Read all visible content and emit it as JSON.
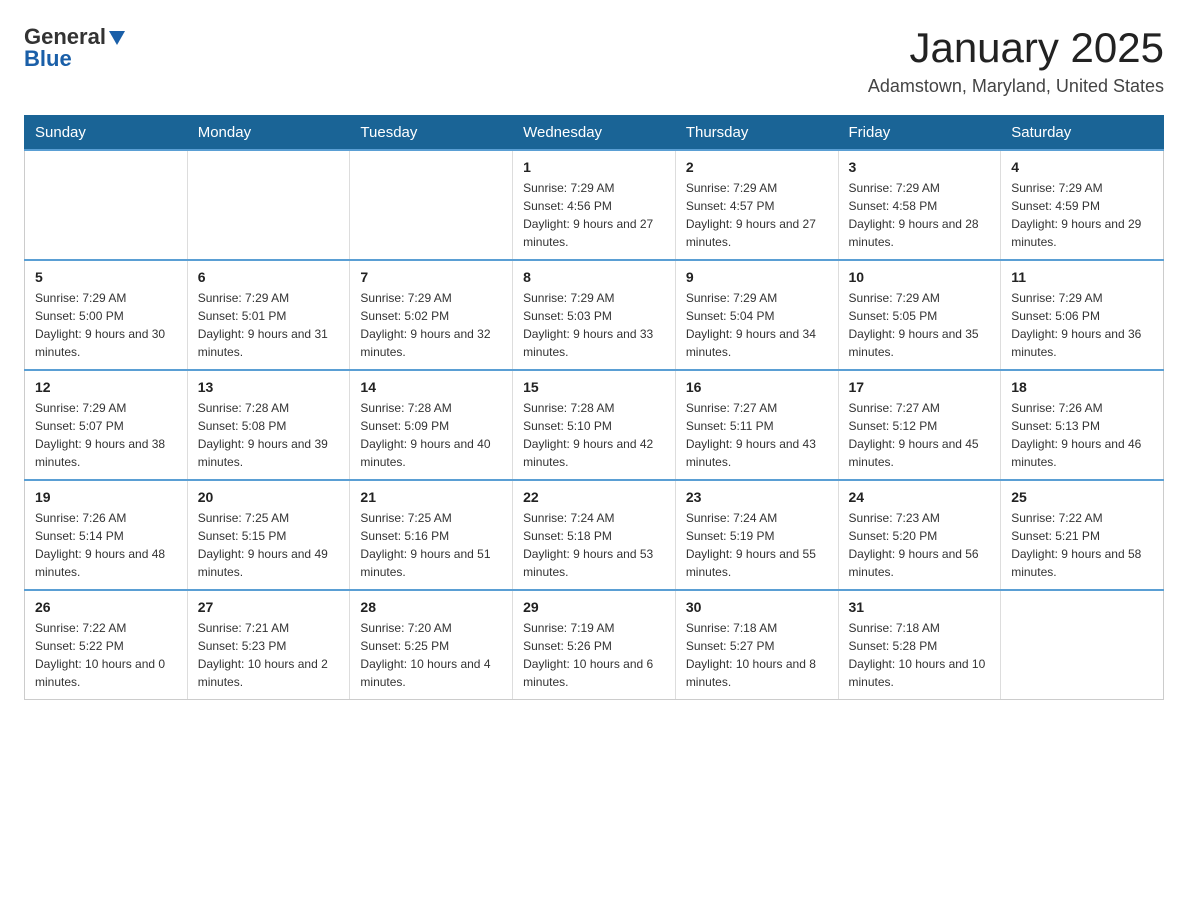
{
  "header": {
    "logo_general": "General",
    "logo_blue": "Blue",
    "title": "January 2025",
    "subtitle": "Adamstown, Maryland, United States"
  },
  "weekdays": [
    "Sunday",
    "Monday",
    "Tuesday",
    "Wednesday",
    "Thursday",
    "Friday",
    "Saturday"
  ],
  "weeks": [
    [
      {
        "day": "",
        "info": ""
      },
      {
        "day": "",
        "info": ""
      },
      {
        "day": "",
        "info": ""
      },
      {
        "day": "1",
        "info": "Sunrise: 7:29 AM\nSunset: 4:56 PM\nDaylight: 9 hours and 27 minutes."
      },
      {
        "day": "2",
        "info": "Sunrise: 7:29 AM\nSunset: 4:57 PM\nDaylight: 9 hours and 27 minutes."
      },
      {
        "day": "3",
        "info": "Sunrise: 7:29 AM\nSunset: 4:58 PM\nDaylight: 9 hours and 28 minutes."
      },
      {
        "day": "4",
        "info": "Sunrise: 7:29 AM\nSunset: 4:59 PM\nDaylight: 9 hours and 29 minutes."
      }
    ],
    [
      {
        "day": "5",
        "info": "Sunrise: 7:29 AM\nSunset: 5:00 PM\nDaylight: 9 hours and 30 minutes."
      },
      {
        "day": "6",
        "info": "Sunrise: 7:29 AM\nSunset: 5:01 PM\nDaylight: 9 hours and 31 minutes."
      },
      {
        "day": "7",
        "info": "Sunrise: 7:29 AM\nSunset: 5:02 PM\nDaylight: 9 hours and 32 minutes."
      },
      {
        "day": "8",
        "info": "Sunrise: 7:29 AM\nSunset: 5:03 PM\nDaylight: 9 hours and 33 minutes."
      },
      {
        "day": "9",
        "info": "Sunrise: 7:29 AM\nSunset: 5:04 PM\nDaylight: 9 hours and 34 minutes."
      },
      {
        "day": "10",
        "info": "Sunrise: 7:29 AM\nSunset: 5:05 PM\nDaylight: 9 hours and 35 minutes."
      },
      {
        "day": "11",
        "info": "Sunrise: 7:29 AM\nSunset: 5:06 PM\nDaylight: 9 hours and 36 minutes."
      }
    ],
    [
      {
        "day": "12",
        "info": "Sunrise: 7:29 AM\nSunset: 5:07 PM\nDaylight: 9 hours and 38 minutes."
      },
      {
        "day": "13",
        "info": "Sunrise: 7:28 AM\nSunset: 5:08 PM\nDaylight: 9 hours and 39 minutes."
      },
      {
        "day": "14",
        "info": "Sunrise: 7:28 AM\nSunset: 5:09 PM\nDaylight: 9 hours and 40 minutes."
      },
      {
        "day": "15",
        "info": "Sunrise: 7:28 AM\nSunset: 5:10 PM\nDaylight: 9 hours and 42 minutes."
      },
      {
        "day": "16",
        "info": "Sunrise: 7:27 AM\nSunset: 5:11 PM\nDaylight: 9 hours and 43 minutes."
      },
      {
        "day": "17",
        "info": "Sunrise: 7:27 AM\nSunset: 5:12 PM\nDaylight: 9 hours and 45 minutes."
      },
      {
        "day": "18",
        "info": "Sunrise: 7:26 AM\nSunset: 5:13 PM\nDaylight: 9 hours and 46 minutes."
      }
    ],
    [
      {
        "day": "19",
        "info": "Sunrise: 7:26 AM\nSunset: 5:14 PM\nDaylight: 9 hours and 48 minutes."
      },
      {
        "day": "20",
        "info": "Sunrise: 7:25 AM\nSunset: 5:15 PM\nDaylight: 9 hours and 49 minutes."
      },
      {
        "day": "21",
        "info": "Sunrise: 7:25 AM\nSunset: 5:16 PM\nDaylight: 9 hours and 51 minutes."
      },
      {
        "day": "22",
        "info": "Sunrise: 7:24 AM\nSunset: 5:18 PM\nDaylight: 9 hours and 53 minutes."
      },
      {
        "day": "23",
        "info": "Sunrise: 7:24 AM\nSunset: 5:19 PM\nDaylight: 9 hours and 55 minutes."
      },
      {
        "day": "24",
        "info": "Sunrise: 7:23 AM\nSunset: 5:20 PM\nDaylight: 9 hours and 56 minutes."
      },
      {
        "day": "25",
        "info": "Sunrise: 7:22 AM\nSunset: 5:21 PM\nDaylight: 9 hours and 58 minutes."
      }
    ],
    [
      {
        "day": "26",
        "info": "Sunrise: 7:22 AM\nSunset: 5:22 PM\nDaylight: 10 hours and 0 minutes."
      },
      {
        "day": "27",
        "info": "Sunrise: 7:21 AM\nSunset: 5:23 PM\nDaylight: 10 hours and 2 minutes."
      },
      {
        "day": "28",
        "info": "Sunrise: 7:20 AM\nSunset: 5:25 PM\nDaylight: 10 hours and 4 minutes."
      },
      {
        "day": "29",
        "info": "Sunrise: 7:19 AM\nSunset: 5:26 PM\nDaylight: 10 hours and 6 minutes."
      },
      {
        "day": "30",
        "info": "Sunrise: 7:18 AM\nSunset: 5:27 PM\nDaylight: 10 hours and 8 minutes."
      },
      {
        "day": "31",
        "info": "Sunrise: 7:18 AM\nSunset: 5:28 PM\nDaylight: 10 hours and 10 minutes."
      },
      {
        "day": "",
        "info": ""
      }
    ]
  ]
}
